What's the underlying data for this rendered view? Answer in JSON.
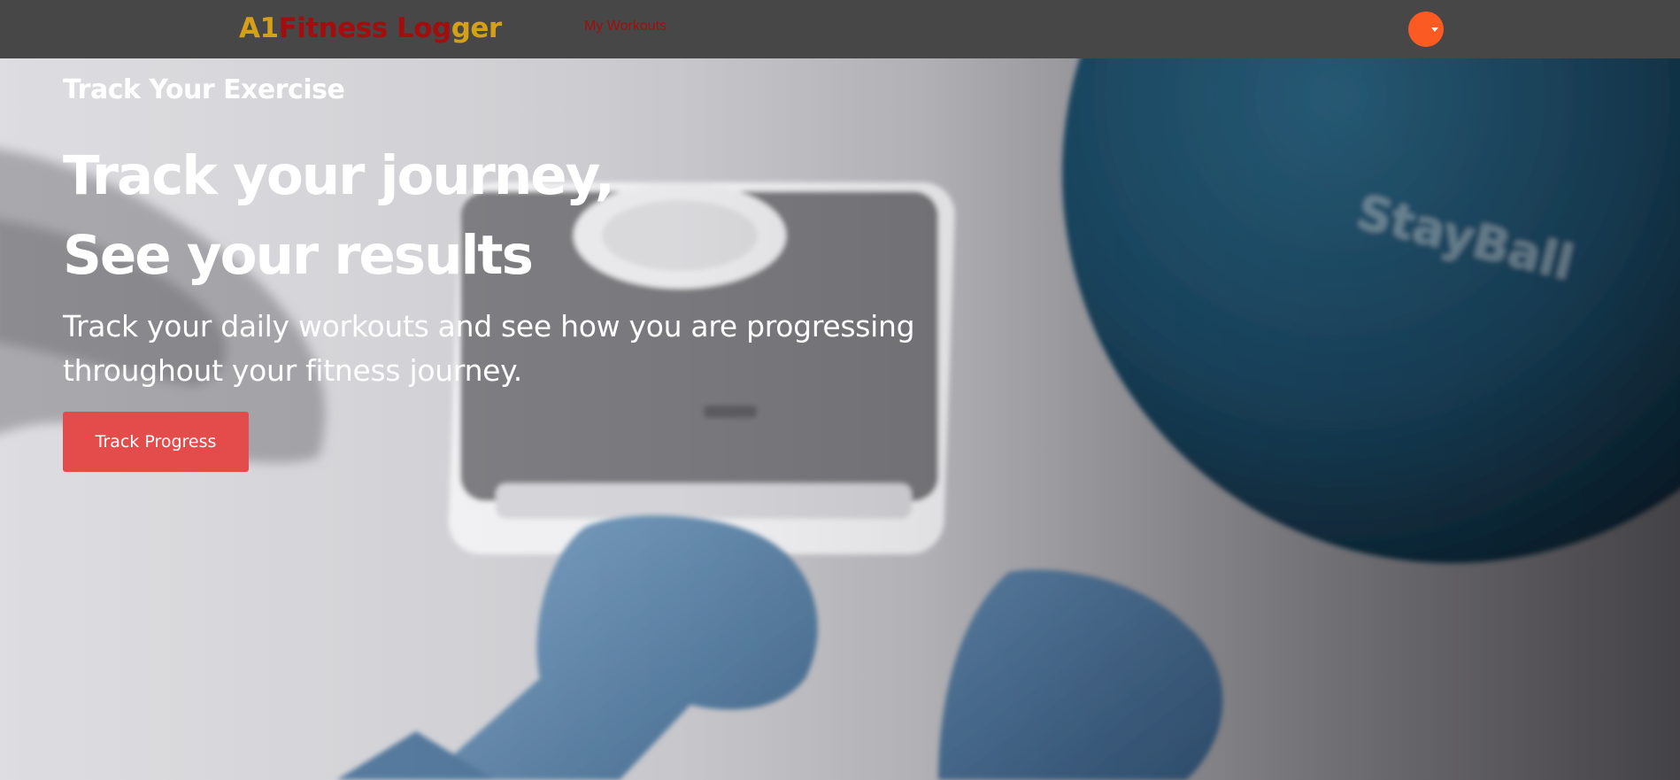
{
  "colors": {
    "navbar_bg": "#474747",
    "brand_gold": "#d4a017",
    "brand_red": "#a30d0d",
    "nav_link": "#a30d0d",
    "avatar": "#fc5a23",
    "cta_bg": "#e44c4c",
    "hero_text": "#ffffff"
  },
  "navbar": {
    "brand": {
      "parts": [
        {
          "text": "A1 ",
          "color": "#d4a017"
        },
        {
          "text": "Fitness Log",
          "color": "#a30d0d"
        },
        {
          "text": "ger",
          "color": "#d4a017"
        }
      ]
    },
    "links": [
      {
        "label": "My Workouts"
      }
    ],
    "user_menu": {
      "icon": "user-avatar-icon",
      "caret_icon": "caret-down-icon"
    }
  },
  "hero": {
    "eyebrow": "Track Your Exercise",
    "headline_line1": "Track your journey,",
    "headline_line2": "See your results",
    "subtext": "Track your daily workouts and see how you are progressing throughout your fitness journey.",
    "cta_label": "Track Progress",
    "background_icon": "fitness-equipment-photo"
  }
}
